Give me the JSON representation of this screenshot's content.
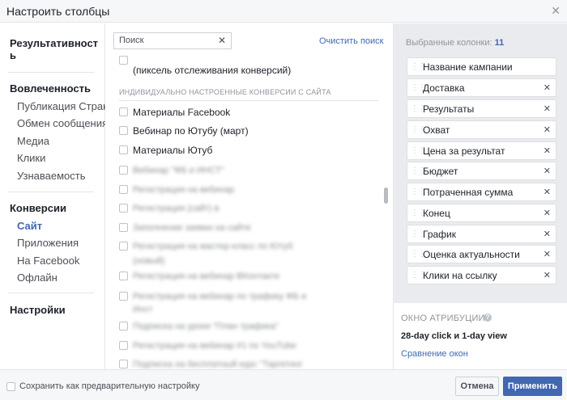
{
  "dialog": {
    "title": "Настроить столбцы",
    "close": "✕"
  },
  "nav": {
    "performance": "Результативност ь",
    "engagement": {
      "title": "Вовлеченность",
      "items": [
        "Публикация Страни",
        "Обмен сообщениям",
        "Медиа",
        "Клики",
        "Узнаваемость"
      ]
    },
    "conversions": {
      "title": "Конверсии",
      "items": [
        "Сайт",
        "Приложения",
        "На Facebook",
        "Офлайн"
      ],
      "active": "Сайт"
    },
    "settings": "Настройки"
  },
  "search": {
    "placeholder": "Поиск",
    "clear_icon": "✕",
    "clear_link": "Очистить поиск"
  },
  "list": {
    "top_item_line2": "(пиксель отслеживания конверсий)",
    "section_heading": "ИНДИВИДУАЛЬНО НАСТРОЕННЫЕ КОНВЕРСИИ С САЙТА",
    "items": [
      "Материалы Facebook",
      "Вебинар по Ютубу (март)",
      "Материалы Ютуб"
    ],
    "blurred_items": [
      "Вебинар \"ФБ и ИНСТ\"",
      "Регистрация на вебинар",
      "Регистрация (сайт) в",
      "Заполнение заявки на сайте",
      "Регистрация на мастер-класс по Ютуб",
      "(новый)",
      "Регистрация на вебинар ВКонтакте",
      "Регистрация на вебинар по трафику ФБ и",
      "Инст",
      "Подписка на уроки \"План трафика\"",
      "Регистрация на вебинар #1 по YouTube",
      "Подписка на бесплатный курс \"Таргетинг"
    ]
  },
  "selected": {
    "label": "Выбранные колонки:",
    "count": "11",
    "columns": [
      "Название кампании",
      "Доставка",
      "Результаты",
      "Охват",
      "Цена за результат",
      "Бюджет",
      "Потраченная сумма",
      "Конец",
      "График",
      "Оценка актуальности",
      "Клики на ссылку"
    ],
    "remove_icon": "✕",
    "grip_icon": "⋮⋮"
  },
  "attribution": {
    "title": "ОКНО АТРИБУЦИИ",
    "info_icon": "?",
    "value": "28-day click и 1-day view",
    "compare_link": "Сравнение окон"
  },
  "footer": {
    "save_preset": "Сохранить как предварительную настройку",
    "cancel": "Отмена",
    "apply": "Применить"
  }
}
